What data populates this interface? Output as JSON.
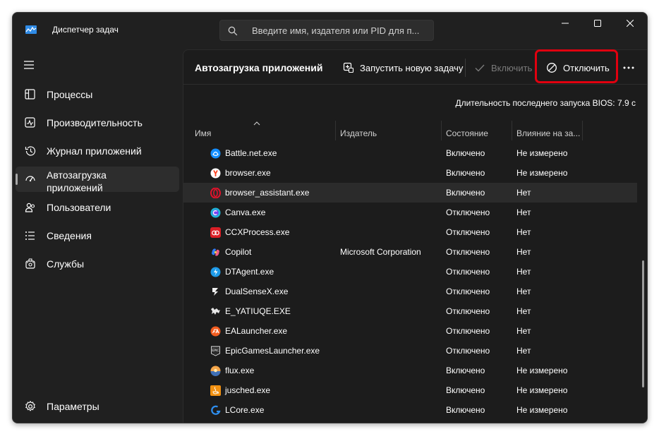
{
  "window": {
    "title": "Диспетчер задач",
    "search_placeholder": "Введите имя, издателя или PID для п..."
  },
  "sidebar": {
    "items": [
      {
        "label": "Процессы",
        "icon": "processes-icon"
      },
      {
        "label": "Производительность",
        "icon": "performance-icon"
      },
      {
        "label": "Журнал приложений",
        "icon": "app-history-icon"
      },
      {
        "label": "Автозагрузка приложений",
        "icon": "startup-apps-icon",
        "active": true
      },
      {
        "label": "Пользователи",
        "icon": "users-icon"
      },
      {
        "label": "Сведения",
        "icon": "details-icon"
      },
      {
        "label": "Службы",
        "icon": "services-icon"
      }
    ],
    "settings_label": "Параметры"
  },
  "toolbar": {
    "page_title": "Автозагрузка приложений",
    "run_new_task": "Запустить новую задачу",
    "enable": "Включить",
    "disable": "Отключить"
  },
  "bios_text": "Длительность последнего запуска BIOS: 7.9 с",
  "table": {
    "columns": [
      "Имя",
      "Издатель",
      "Состояние",
      "Влияние на за..."
    ],
    "rows": [
      {
        "name": "Battle.net.exe",
        "publisher": "",
        "state": "Включено",
        "impact": "Не измерено",
        "icon": "battlenet-icon"
      },
      {
        "name": "browser.exe",
        "publisher": "",
        "state": "Включено",
        "impact": "Не измерено",
        "icon": "yandex-browser-icon"
      },
      {
        "name": "browser_assistant.exe",
        "publisher": "",
        "state": "Включено",
        "impact": "Нет",
        "icon": "opera-icon",
        "selected": true
      },
      {
        "name": "Canva.exe",
        "publisher": "",
        "state": "Отключено",
        "impact": "Нет",
        "icon": "canva-icon"
      },
      {
        "name": "CCXProcess.exe",
        "publisher": "",
        "state": "Отключено",
        "impact": "Нет",
        "icon": "adobe-cc-icon"
      },
      {
        "name": "Copilot",
        "publisher": "Microsoft Corporation",
        "state": "Отключено",
        "impact": "Нет",
        "icon": "copilot-icon"
      },
      {
        "name": "DTAgent.exe",
        "publisher": "",
        "state": "Отключено",
        "impact": "Нет",
        "icon": "daemon-tools-icon"
      },
      {
        "name": "DualSenseX.exe",
        "publisher": "",
        "state": "Отключено",
        "impact": "Нет",
        "icon": "dualsensex-icon"
      },
      {
        "name": "E_YATIUQE.EXE",
        "publisher": "",
        "state": "Отключено",
        "impact": "Нет",
        "icon": "epson-icon"
      },
      {
        "name": "EALauncher.exe",
        "publisher": "",
        "state": "Отключено",
        "impact": "Нет",
        "icon": "ea-icon"
      },
      {
        "name": "EpicGamesLauncher.exe",
        "publisher": "",
        "state": "Отключено",
        "impact": "Нет",
        "icon": "epic-games-icon"
      },
      {
        "name": "flux.exe",
        "publisher": "",
        "state": "Включено",
        "impact": "Не измерено",
        "icon": "flux-icon"
      },
      {
        "name": "jusched.exe",
        "publisher": "",
        "state": "Включено",
        "impact": "Не измерено",
        "icon": "java-icon"
      },
      {
        "name": "LCore.exe",
        "publisher": "",
        "state": "Включено",
        "impact": "Не измерено",
        "icon": "logitech-icon"
      }
    ]
  },
  "colors": {
    "window_bg": "#202020",
    "content_bg": "#1c1c1c",
    "highlight": "#e0000f",
    "selected_row": "#2b2b2b"
  }
}
